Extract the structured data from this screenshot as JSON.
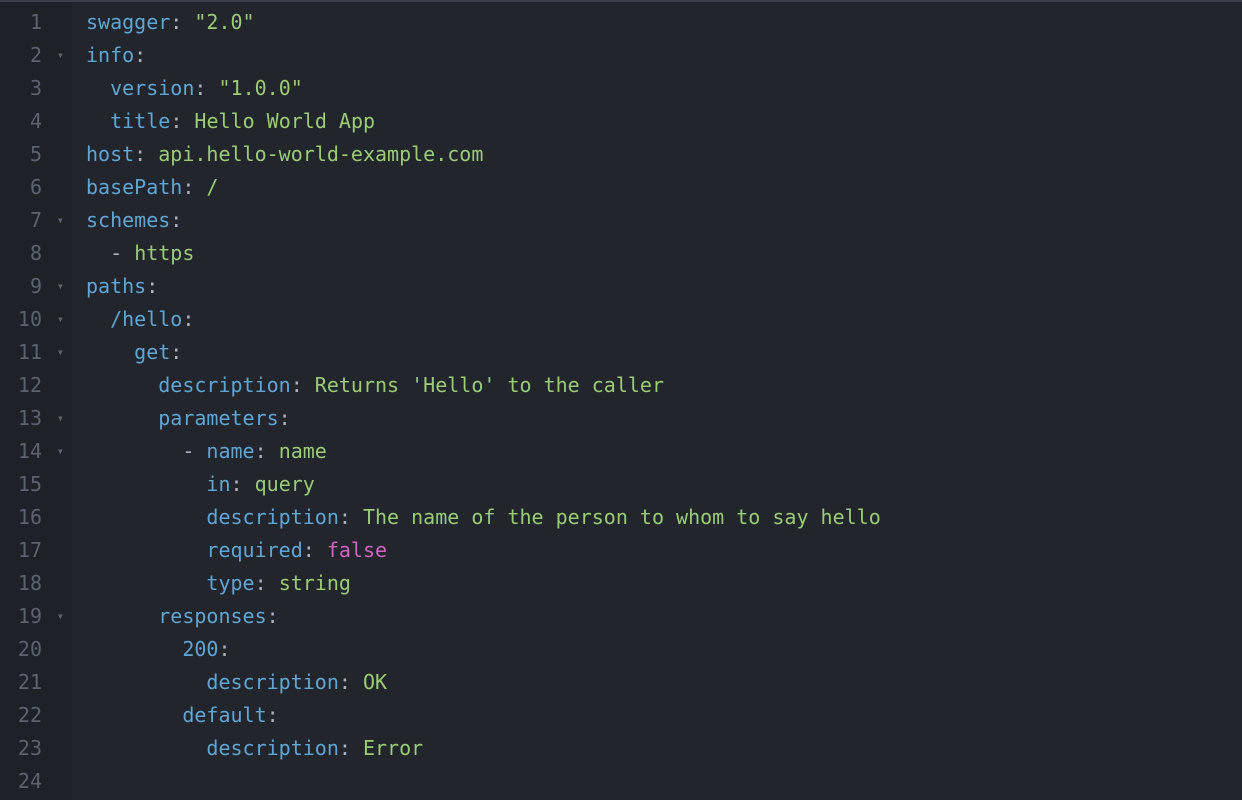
{
  "gutter": {
    "lines": [
      {
        "num": "1",
        "fold": ""
      },
      {
        "num": "2",
        "fold": "▾"
      },
      {
        "num": "3",
        "fold": ""
      },
      {
        "num": "4",
        "fold": ""
      },
      {
        "num": "5",
        "fold": ""
      },
      {
        "num": "6",
        "fold": ""
      },
      {
        "num": "7",
        "fold": "▾"
      },
      {
        "num": "8",
        "fold": ""
      },
      {
        "num": "9",
        "fold": "▾"
      },
      {
        "num": "10",
        "fold": "▾"
      },
      {
        "num": "11",
        "fold": "▾"
      },
      {
        "num": "12",
        "fold": ""
      },
      {
        "num": "13",
        "fold": "▾"
      },
      {
        "num": "14",
        "fold": "▾"
      },
      {
        "num": "15",
        "fold": ""
      },
      {
        "num": "16",
        "fold": ""
      },
      {
        "num": "17",
        "fold": ""
      },
      {
        "num": "18",
        "fold": ""
      },
      {
        "num": "19",
        "fold": "▾"
      },
      {
        "num": "20",
        "fold": ""
      },
      {
        "num": "21",
        "fold": ""
      },
      {
        "num": "22",
        "fold": ""
      },
      {
        "num": "23",
        "fold": ""
      },
      {
        "num": "24",
        "fold": ""
      }
    ]
  },
  "code": {
    "lines": [
      {
        "indent": "",
        "tokens": [
          {
            "cls": "key",
            "t": "swagger"
          },
          {
            "cls": "colon",
            "t": ": "
          },
          {
            "cls": "str",
            "t": "\"2.0\""
          }
        ]
      },
      {
        "indent": "",
        "tokens": [
          {
            "cls": "key",
            "t": "info"
          },
          {
            "cls": "colon",
            "t": ":"
          }
        ]
      },
      {
        "indent": "  ",
        "tokens": [
          {
            "cls": "key",
            "t": "version"
          },
          {
            "cls": "colon",
            "t": ": "
          },
          {
            "cls": "str",
            "t": "\"1.0.0\""
          }
        ]
      },
      {
        "indent": "  ",
        "tokens": [
          {
            "cls": "key",
            "t": "title"
          },
          {
            "cls": "colon",
            "t": ": "
          },
          {
            "cls": "plain",
            "t": "Hello World App"
          }
        ]
      },
      {
        "indent": "",
        "tokens": [
          {
            "cls": "key",
            "t": "host"
          },
          {
            "cls": "colon",
            "t": ": "
          },
          {
            "cls": "plain",
            "t": "api.hello-world-example.com"
          }
        ]
      },
      {
        "indent": "",
        "tokens": [
          {
            "cls": "key",
            "t": "basePath"
          },
          {
            "cls": "colon",
            "t": ": "
          },
          {
            "cls": "plain",
            "t": "/"
          }
        ]
      },
      {
        "indent": "",
        "tokens": [
          {
            "cls": "key",
            "t": "schemes"
          },
          {
            "cls": "colon",
            "t": ":"
          }
        ]
      },
      {
        "indent": "  ",
        "tokens": [
          {
            "cls": "dash",
            "t": "- "
          },
          {
            "cls": "plain",
            "t": "https"
          }
        ]
      },
      {
        "indent": "",
        "tokens": [
          {
            "cls": "key",
            "t": "paths"
          },
          {
            "cls": "colon",
            "t": ":"
          }
        ]
      },
      {
        "indent": "  ",
        "tokens": [
          {
            "cls": "key",
            "t": "/hello"
          },
          {
            "cls": "colon",
            "t": ":"
          }
        ]
      },
      {
        "indent": "    ",
        "tokens": [
          {
            "cls": "key",
            "t": "get"
          },
          {
            "cls": "colon",
            "t": ":"
          }
        ]
      },
      {
        "indent": "      ",
        "tokens": [
          {
            "cls": "key",
            "t": "description"
          },
          {
            "cls": "colon",
            "t": ": "
          },
          {
            "cls": "plain",
            "t": "Returns 'Hello' to the caller"
          }
        ]
      },
      {
        "indent": "      ",
        "tokens": [
          {
            "cls": "key",
            "t": "parameters"
          },
          {
            "cls": "colon",
            "t": ":"
          }
        ]
      },
      {
        "indent": "        ",
        "tokens": [
          {
            "cls": "dash",
            "t": "- "
          },
          {
            "cls": "key",
            "t": "name"
          },
          {
            "cls": "colon",
            "t": ": "
          },
          {
            "cls": "plain",
            "t": "name"
          }
        ]
      },
      {
        "indent": "          ",
        "tokens": [
          {
            "cls": "key",
            "t": "in"
          },
          {
            "cls": "colon",
            "t": ": "
          },
          {
            "cls": "plain",
            "t": "query"
          }
        ]
      },
      {
        "indent": "          ",
        "tokens": [
          {
            "cls": "key",
            "t": "description"
          },
          {
            "cls": "colon",
            "t": ": "
          },
          {
            "cls": "plain",
            "t": "The name of the person to whom to say hello"
          }
        ]
      },
      {
        "indent": "          ",
        "tokens": [
          {
            "cls": "key",
            "t": "required"
          },
          {
            "cls": "colon",
            "t": ": "
          },
          {
            "cls": "bool",
            "t": "false"
          }
        ]
      },
      {
        "indent": "          ",
        "tokens": [
          {
            "cls": "key",
            "t": "type"
          },
          {
            "cls": "colon",
            "t": ": "
          },
          {
            "cls": "plain",
            "t": "string"
          }
        ]
      },
      {
        "indent": "      ",
        "tokens": [
          {
            "cls": "key",
            "t": "responses"
          },
          {
            "cls": "colon",
            "t": ":"
          }
        ]
      },
      {
        "indent": "        ",
        "tokens": [
          {
            "cls": "key",
            "t": "200"
          },
          {
            "cls": "colon",
            "t": ":"
          }
        ]
      },
      {
        "indent": "          ",
        "tokens": [
          {
            "cls": "key",
            "t": "description"
          },
          {
            "cls": "colon",
            "t": ": "
          },
          {
            "cls": "plain",
            "t": "OK"
          }
        ]
      },
      {
        "indent": "        ",
        "tokens": [
          {
            "cls": "key",
            "t": "default"
          },
          {
            "cls": "colon",
            "t": ":"
          }
        ]
      },
      {
        "indent": "          ",
        "tokens": [
          {
            "cls": "key",
            "t": "description"
          },
          {
            "cls": "colon",
            "t": ": "
          },
          {
            "cls": "plain",
            "t": "Error"
          }
        ]
      },
      {
        "indent": "",
        "tokens": []
      }
    ]
  }
}
